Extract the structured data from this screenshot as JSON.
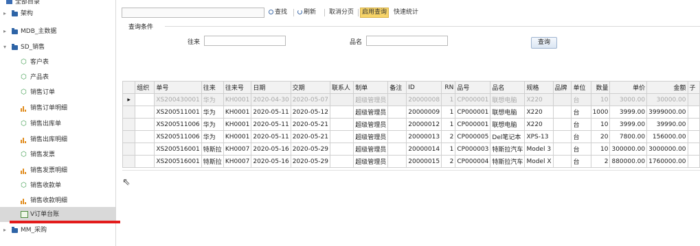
{
  "sidebar": {
    "top_label": "全部目录",
    "items": [
      {
        "label": "架构",
        "kind": "folder",
        "expand": "▸"
      },
      {
        "label": "MDB_主数据",
        "kind": "folder",
        "expand": "▸"
      },
      {
        "label": "SD_销售",
        "kind": "folder",
        "expand": "▾"
      },
      {
        "label": "客户表",
        "kind": "cube"
      },
      {
        "label": "产品表",
        "kind": "cube"
      },
      {
        "label": "销售订单",
        "kind": "cube"
      },
      {
        "label": "销售订单明细",
        "kind": "bars"
      },
      {
        "label": "销售出库单",
        "kind": "cube"
      },
      {
        "label": "销售出库明细",
        "kind": "bars"
      },
      {
        "label": "销售发票",
        "kind": "cube"
      },
      {
        "label": "销售发票明细",
        "kind": "bars"
      },
      {
        "label": "销售收款单",
        "kind": "cube"
      },
      {
        "label": "销售收款明细",
        "kind": "bars"
      },
      {
        "label": "V订单台账",
        "kind": "table",
        "selected": true
      },
      {
        "label": "MM_采购",
        "kind": "folder",
        "expand": "▸"
      }
    ]
  },
  "toolbar": {
    "search_label": "查找",
    "refresh_label": "刷新",
    "cancel_paging_label": "取消分页",
    "enable_query_label": "启用查询",
    "quick_stats_label": "快速统计"
  },
  "query_panel": {
    "title": "查询条件",
    "field1_label": "往来",
    "field1_value": "",
    "field2_label": "品名",
    "field2_value": "",
    "query_button": "查询"
  },
  "grid": {
    "columns": [
      "",
      "组织",
      "单号",
      "往来",
      "往来号",
      "日期",
      "交期",
      "联系人",
      "制单",
      "备注",
      "ID",
      "RN",
      "品号",
      "品名",
      "规格",
      "品牌",
      "单位",
      "数量",
      "单价",
      "金额",
      "子"
    ],
    "rows": [
      [
        "▸",
        "",
        "XS200430001",
        "华为",
        "KH0001",
        "2020-04-30",
        "2020-05-07",
        "",
        "超级管理员",
        "",
        "20000008",
        "1",
        "CP000001",
        "联想电脑",
        "X220",
        "",
        "台",
        "10",
        "3000.00",
        "30000.00",
        ""
      ],
      [
        "",
        "",
        "XS200511001",
        "华为",
        "KH0001",
        "2020-05-11",
        "2020-05-12",
        "",
        "超级管理员",
        "",
        "20000009",
        "1",
        "CP000001",
        "联想电脑",
        "X220",
        "",
        "台",
        "1000",
        "3999.00",
        "3999000.00",
        ""
      ],
      [
        "",
        "",
        "XS200511006",
        "华为",
        "KH0001",
        "2020-05-11",
        "2020-05-21",
        "",
        "超级管理员",
        "",
        "20000012",
        "1",
        "CP000001",
        "联想电脑",
        "X220",
        "",
        "台",
        "10",
        "3999.00",
        "39990.00",
        ""
      ],
      [
        "",
        "",
        "XS200511006",
        "华为",
        "KH0001",
        "2020-05-11",
        "2020-05-21",
        "",
        "超级管理员",
        "",
        "20000013",
        "2",
        "CP000005",
        "Del笔记本",
        "XPS-13",
        "",
        "台",
        "20",
        "7800.00",
        "156000.00",
        ""
      ],
      [
        "",
        "",
        "XS200516001",
        "特斯拉",
        "KH0007",
        "2020-05-16",
        "2020-05-29",
        "",
        "超级管理员",
        "",
        "20000014",
        "1",
        "CP000003",
        "特斯拉汽车",
        "Model 3",
        "",
        "台",
        "10",
        "300000.00",
        "3000000.00",
        ""
      ],
      [
        "",
        "",
        "XS200516001",
        "特斯拉",
        "KH0007",
        "2020-05-16",
        "2020-05-29",
        "",
        "超级管理员",
        "",
        "20000015",
        "2",
        "CP000004",
        "特斯拉汽车",
        "Model X",
        "",
        "台",
        "2",
        "880000.00",
        "1760000.00",
        ""
      ]
    ]
  }
}
